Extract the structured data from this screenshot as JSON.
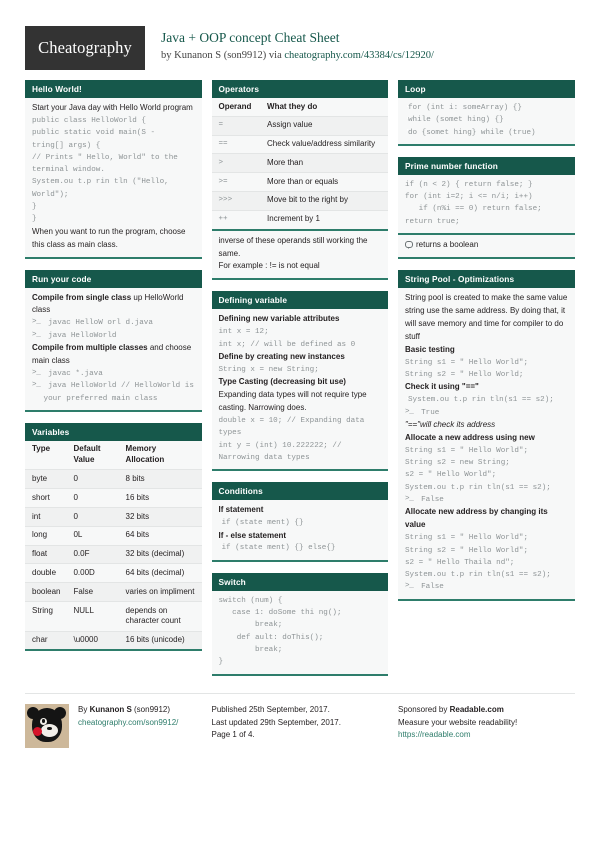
{
  "brand": {
    "logo_text": "Cheatography",
    "accent": "#16584b",
    "rule": "#2e7d6b",
    "logo_bg": "#333333"
  },
  "header": {
    "title": "Java + OOP concept Cheat Sheet",
    "byline_prefix": "by ",
    "author": "Kunanon S (son9912)",
    "byline_mid": " via ",
    "source_url": "cheatography.com/43384/cs/12920/"
  },
  "columns": [
    {
      "cards": [
        {
          "title": "Hello World!",
          "type": "lines",
          "lines": [
            {
              "kind": "text",
              "text": "Start your Java day with Hello World program"
            },
            {
              "kind": "code",
              "text": "public class HelloWorld {"
            },
            {
              "kind": "code",
              "text": "public static void main(S -"
            },
            {
              "kind": "code",
              "text": "tring[] args) {"
            },
            {
              "kind": "code",
              "text": "// Prints \" Hello, World\" to the"
            },
            {
              "kind": "code",
              "text": "terminal window."
            },
            {
              "kind": "code",
              "text": "System.ou t.p rin tln (\"Hello,"
            },
            {
              "kind": "code",
              "text": "World\");"
            },
            {
              "kind": "code",
              "text": "}"
            },
            {
              "kind": "code",
              "text": "}"
            },
            {
              "kind": "text",
              "text": "When you want to run the program, choose this class as main class."
            }
          ]
        },
        {
          "title": "Run your code",
          "type": "lines",
          "lines": [
            {
              "kind": "bold",
              "text": "Compile from single class",
              "tail": " up HelloWorld class"
            },
            {
              "kind": "term",
              "text": "javac HelloW orl d.java"
            },
            {
              "kind": "term",
              "text": "java HelloWorld"
            },
            {
              "kind": "bold",
              "text": "Compile from multiple classes",
              "tail": " and choose main class"
            },
            {
              "kind": "term",
              "text": "javac *.java"
            },
            {
              "kind": "term",
              "text": "java HelloWorld // HelloWorld is your preferred main class"
            }
          ]
        },
        {
          "title": "Variables",
          "type": "table",
          "headers": [
            "Type",
            "Default Value",
            "Memory Allocation"
          ],
          "rows": [
            [
              "byte",
              "0",
              "8 bits"
            ],
            [
              "short",
              "0",
              "16 bits"
            ],
            [
              "int",
              "0",
              "32 bits"
            ],
            [
              "long",
              "0L",
              "64 bits"
            ],
            [
              "float",
              "0.0F",
              "32 bits (decimal)"
            ],
            [
              "double",
              "0.00D",
              "64 bits (decimal)"
            ],
            [
              "boolean",
              "False",
              "varies on impliment"
            ],
            [
              "String",
              "NULL",
              "depends on character count"
            ],
            [
              "char",
              "\\u0000",
              "16 bits (unicode)"
            ]
          ]
        }
      ]
    },
    {
      "cards": [
        {
          "title": "Operators",
          "type": "table",
          "headers": [
            "Operand",
            "What they do"
          ],
          "mono_first_col": true,
          "rows": [
            [
              "=",
              "Assign value"
            ],
            [
              "==",
              "Check value/address similarity"
            ],
            [
              ">",
              "More than"
            ],
            [
              ">=",
              "More than or equals"
            ],
            [
              ">>>",
              "Move bit to the right by"
            ],
            [
              "++",
              "Increment by 1"
            ]
          ],
          "note": [
            "inverse of these operands still working the same.",
            "For example : != is not equal"
          ]
        },
        {
          "title": "Defining variable",
          "type": "lines",
          "lines": [
            {
              "kind": "bold",
              "text": "Defining new variable attributes"
            },
            {
              "kind": "code",
              "text": "int x = 12;"
            },
            {
              "kind": "code",
              "text": "int x; // will be defined as 0"
            },
            {
              "kind": "bold",
              "text": "Define by creating new instances"
            },
            {
              "kind": "code",
              "text": "String x = new String;"
            },
            {
              "kind": "bold",
              "text": "Type Casting (decreasing bit use)"
            },
            {
              "kind": "text",
              "text": "Expanding data types will not require type casting. Narrowing does."
            },
            {
              "kind": "code",
              "text": "double x = 10; // Expanding data types"
            },
            {
              "kind": "code",
              "text": "int y = (int) 10.222222; // Narrowing data types"
            }
          ]
        },
        {
          "title": "Conditions",
          "type": "lines",
          "lines": [
            {
              "kind": "bold",
              "text": "If statement"
            },
            {
              "kind": "play",
              "text": "if (state ment) {}"
            },
            {
              "kind": "bold",
              "text": "If - else statement"
            },
            {
              "kind": "play",
              "text": "if (state ment) {} else{}"
            }
          ]
        },
        {
          "title": "Switch",
          "type": "lines",
          "lines": [
            {
              "kind": "code",
              "text": "switch (num) {"
            },
            {
              "kind": "code",
              "text": "   case 1: doSome thi ng();"
            },
            {
              "kind": "code",
              "text": "        break;"
            },
            {
              "kind": "code",
              "text": "    def ault: doThis();"
            },
            {
              "kind": "code",
              "text": "        break;"
            },
            {
              "kind": "code",
              "text": "}"
            }
          ]
        }
      ]
    },
    {
      "cards": [
        {
          "title": "Loop",
          "type": "lines",
          "lines": [
            {
              "kind": "play",
              "text": "for (int i: someArray) {}"
            },
            {
              "kind": "play",
              "text": "while (somet hing) {}"
            },
            {
              "kind": "play",
              "text": "do {somet hing} while (true)"
            }
          ]
        },
        {
          "title": "Prime number function",
          "type": "lines",
          "lines": [
            {
              "kind": "code",
              "text": "if (n < 2) { return false; }"
            },
            {
              "kind": "code",
              "text": "for (int i=2; i <= n/i; i++)"
            },
            {
              "kind": "code",
              "text": "   if (n%i == 0) return false;"
            },
            {
              "kind": "code",
              "text": "return true;"
            }
          ],
          "note_bubble": "returns a boolean"
        },
        {
          "title": "String Pool - Optimizations",
          "type": "lines",
          "lines": [
            {
              "kind": "text",
              "text": "String pool is created to make the same value string use the same address. By doing that, it will save memory and time for compiler to do stuff"
            },
            {
              "kind": "bold",
              "text": "Basic testing"
            },
            {
              "kind": "code",
              "text": "String s1 = \" Hello World\";"
            },
            {
              "kind": "code",
              "text": "String s2 = \" Hello World;"
            },
            {
              "kind": "bold",
              "text": "Check it using \"==\""
            },
            {
              "kind": "play",
              "text": "System.ou t.p rin tln(s1 == s2);"
            },
            {
              "kind": "term",
              "text": "True"
            },
            {
              "kind": "italic",
              "text": "\"==\"will check its address"
            },
            {
              "kind": "bold",
              "text": "Allocate a new address using new"
            },
            {
              "kind": "code",
              "text": "String s1 = \" Hello World\";"
            },
            {
              "kind": "code",
              "text": "String s2 = new String;"
            },
            {
              "kind": "code",
              "text": "s2 = \" Hello World\";"
            },
            {
              "kind": "code",
              "text": "System.ou t.p rin tln(s1 == s2);"
            },
            {
              "kind": "term",
              "text": "False"
            },
            {
              "kind": "bold",
              "text": "Allocate new address by changing its value"
            },
            {
              "kind": "code",
              "text": "String s1 = \" Hello World\";"
            },
            {
              "kind": "code",
              "text": "String s2 = \" Hello World\";"
            },
            {
              "kind": "code",
              "text": "s2 = \" Hello Thaila nd\";"
            },
            {
              "kind": "code",
              "text": "System.ou t.p rin tln(s1 == s2);"
            },
            {
              "kind": "term",
              "text": "False"
            }
          ]
        }
      ]
    }
  ],
  "footer": {
    "author_prefix": "By ",
    "author_name": "Kunanon S",
    "author_handle": " (son9912)",
    "author_url": "cheatography.com/son9912/",
    "published": "Published 25th September, 2017.",
    "updated": "Last updated 29th September, 2017.",
    "page": "Page 1 of 4.",
    "sponsor_prefix": "Sponsored by ",
    "sponsor_name": "Readable.com",
    "sponsor_tagline": "Measure your website readability!",
    "sponsor_url": "https://readable.com"
  }
}
